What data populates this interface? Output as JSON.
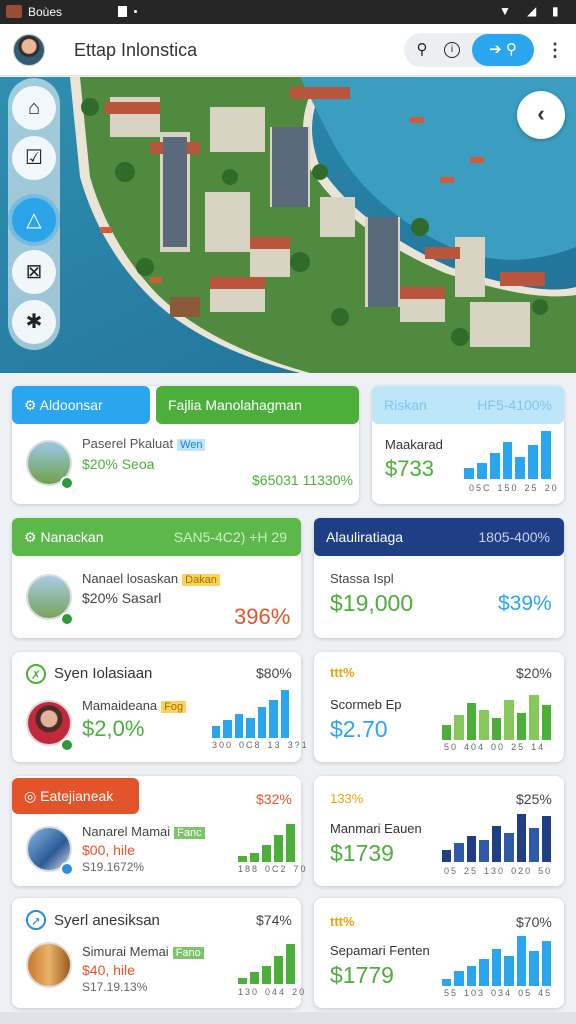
{
  "status_bar": {
    "title": "Boùes"
  },
  "header": {
    "title": "Ettap Inlonstica"
  },
  "rail": {
    "items": [
      "home",
      "task",
      "navigate",
      "grid",
      "settings"
    ]
  },
  "row1": {
    "tab_a": "Aldoonsar",
    "tab_b": "Fajlia Manolahagman",
    "card_a": {
      "name": "Paserel Pkaluat",
      "tag": "Wen",
      "value": "$20% Seoa",
      "footer": "$65031 11330%"
    },
    "tab_c": "Riskan",
    "tab_c_right": "HF5-4100%",
    "card_c": {
      "label": "Maakarad",
      "value": "$733",
      "ticks": [
        "05C",
        "150",
        "25",
        "20"
      ],
      "bars": [
        0.22,
        0.34,
        0.55,
        0.78,
        0.45,
        0.7,
        1.0
      ]
    }
  },
  "row2": {
    "tab_a": "Nanackan",
    "tab_a_right": "SAN5-4C2) +H 29",
    "card_a": {
      "name": "Nanael losaskan",
      "tag": "Dakan",
      "value": "$20% Sasarl",
      "big": "396%"
    },
    "tab_b": "Alauliratiaga",
    "tab_b_right": "1805-400%",
    "card_b": {
      "label": "Stassa Ispl",
      "value": "$19,000",
      "pct": "$39%"
    }
  },
  "row3": {
    "card_a": {
      "title": "Syen Iolasiaan",
      "pct": "$80%",
      "name": "Mamaideana",
      "tag": "Fog",
      "value": "$2,0%",
      "ticks": [
        "300",
        "0C8",
        "13",
        "3?1"
      ],
      "bars": [
        0.25,
        0.38,
        0.5,
        0.42,
        0.65,
        0.8,
        1.0
      ]
    },
    "card_b": {
      "title": "ttt%",
      "pct": "$20%",
      "label": "Scormeb Ep",
      "value": "$2.70",
      "ticks": [
        "50",
        "404",
        "00",
        "25",
        "14"
      ],
      "bars": [
        0.3,
        0.5,
        0.75,
        0.6,
        0.45,
        0.8,
        0.55,
        0.9,
        0.7
      ]
    }
  },
  "row4": {
    "tab_a": "Eatejianeak",
    "card_a": {
      "pct": "$32%",
      "name": "Nanarel Mamai",
      "tag": "Fanc",
      "value": "$00, hile",
      "sub": "S19.1672%",
      "ticks": [
        "188",
        "0C2",
        "70"
      ],
      "bars": [
        0.15,
        0.25,
        0.45,
        0.7,
        1.0
      ]
    },
    "card_b": {
      "title": "133%",
      "pct": "$25%",
      "label": "Manmari Eauen",
      "value": "$1739",
      "ticks": [
        "05",
        "25",
        "130",
        "020",
        "50"
      ],
      "bars": [
        0.25,
        0.4,
        0.55,
        0.45,
        0.75,
        0.6,
        1.0,
        0.7,
        0.95
      ]
    }
  },
  "row5": {
    "card_a": {
      "title": "Syerl anesiksan",
      "pct": "$74%",
      "name": "Simurai Memai",
      "tag": "Fano",
      "value": "$40, hile",
      "sub": "S17.19.13%",
      "ticks": [
        "130",
        "044",
        "20"
      ],
      "bars": [
        0.15,
        0.3,
        0.45,
        0.7,
        1.0
      ]
    },
    "card_b": {
      "title": "ttt%",
      "pct": "$70%",
      "label": "Sepamari Fenten",
      "value": "$1779",
      "ticks": [
        "55",
        "103",
        "034",
        "05",
        "45"
      ],
      "bars": [
        0.15,
        0.3,
        0.4,
        0.55,
        0.75,
        0.6,
        1.0,
        0.7,
        0.9
      ]
    }
  },
  "colors": {
    "blue": "#29a6ee",
    "green": "#4caf3a",
    "navy": "#1f3e83",
    "orange": "#e4542b",
    "accent_red": "#e4542b"
  }
}
